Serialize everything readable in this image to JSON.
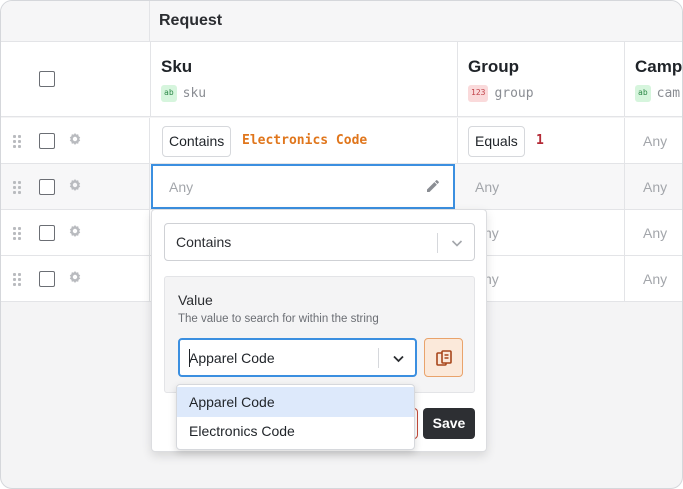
{
  "table": {
    "group_title": "Request",
    "columns": [
      {
        "name": "Sku",
        "type_badge": "ab",
        "key": "sku"
      },
      {
        "name": "Group",
        "type_badge": "123",
        "key": "group"
      },
      {
        "name": "Camp",
        "type_badge": "ab",
        "key": "cam"
      }
    ],
    "rows": [
      {
        "sku_operator": "Contains",
        "sku_value": "Electronics Code",
        "group_operator": "Equals",
        "group_value": "1",
        "camp_value": "Any"
      },
      {
        "sku_placeholder": "Any",
        "group_value": "Any",
        "camp_value": "Any"
      },
      {
        "group_value": "ny",
        "camp_value": "Any"
      },
      {
        "group_value": "ny",
        "camp_value": "Any"
      }
    ]
  },
  "editor": {
    "operator": "Contains",
    "value_label": "Value",
    "value_description": "The value to search for within the string",
    "value_current": "Apparel Code",
    "options": [
      "Apparel Code",
      "Electronics Code"
    ],
    "save_label": "Save"
  },
  "colors": {
    "accent_blue": "#3b8fe0",
    "string_value_orange": "#e0761c",
    "number_value_red": "#b42a36",
    "save_button": "#2d2f33"
  },
  "icons": [
    "drag-handle-icon",
    "gear-icon",
    "pencil-icon",
    "chevron-down-icon",
    "paste-icon"
  ]
}
